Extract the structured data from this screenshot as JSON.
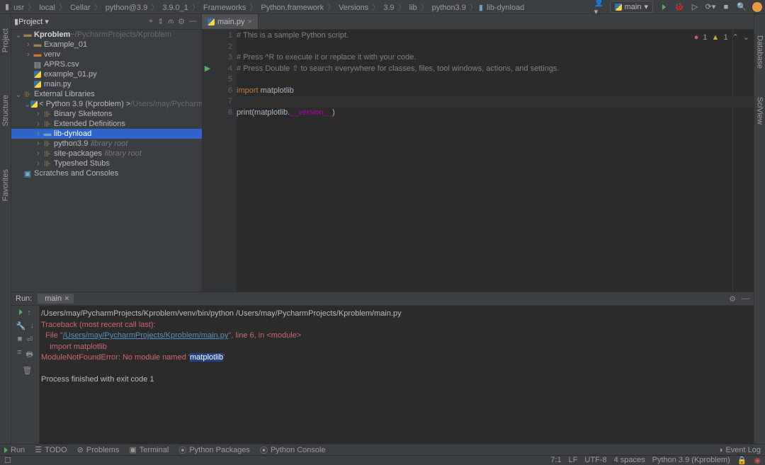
{
  "breadcrumb": [
    "usr",
    "local",
    "Cellar",
    "python@3.9",
    "3.9.0_1",
    "Frameworks",
    "Python.framework",
    "Versions",
    "3.9",
    "lib",
    "python3.9",
    "lib-dynload"
  ],
  "runconfig": {
    "name": "main"
  },
  "top_icons": {
    "run": "run-icon",
    "debug": "bug-icon",
    "more": "more-icon",
    "refresh": "refresh-icon",
    "search": "search-icon"
  },
  "project_panel": {
    "title": "Project",
    "icons": {
      "target": "⌖",
      "collapse": "⇕",
      "split": "⫙",
      "settings": "⚙",
      "hide": "—"
    }
  },
  "tree": [
    {
      "depth": 0,
      "chev": "v",
      "icon": "fld",
      "label": "Kproblem",
      "suffix": "~/PycharmProjects/Kproblem",
      "bold": true
    },
    {
      "depth": 1,
      "chev": ">",
      "icon": "fld",
      "label": "Example_01"
    },
    {
      "depth": 1,
      "chev": ">",
      "icon": "fld-o",
      "label": "venv"
    },
    {
      "depth": 1,
      "chev": "",
      "icon": "file",
      "label": "APRS.csv"
    },
    {
      "depth": 1,
      "chev": "",
      "icon": "py",
      "label": "example_01.py"
    },
    {
      "depth": 1,
      "chev": "",
      "icon": "py",
      "label": "main.py"
    },
    {
      "depth": 0,
      "chev": "v",
      "icon": "ext",
      "label": "External Libraries"
    },
    {
      "depth": 1,
      "chev": "v",
      "icon": "py",
      "label": "< Python 3.9 (Kproblem) >",
      "suffix": "/Users/may/PycharmPro"
    },
    {
      "depth": 2,
      "chev": ">",
      "icon": "lib",
      "label": "Binary Skeletons"
    },
    {
      "depth": 2,
      "chev": ">",
      "icon": "lib",
      "label": "Extended Definitions"
    },
    {
      "depth": 2,
      "chev": ">",
      "icon": "fld-b",
      "label": "lib-dynload",
      "selected": true
    },
    {
      "depth": 2,
      "chev": ">",
      "icon": "lib",
      "label": "python3.9",
      "suffix": "library root"
    },
    {
      "depth": 2,
      "chev": ">",
      "icon": "lib",
      "label": "site-packages",
      "suffix": "library root"
    },
    {
      "depth": 2,
      "chev": ">",
      "icon": "lib",
      "label": "Typeshed Stubs"
    },
    {
      "depth": 0,
      "chev": "",
      "icon": "scratch",
      "label": "Scratches and Consoles"
    }
  ],
  "editor": {
    "tab": "main.py",
    "annotation": {
      "errors": "1",
      "warnings": "1"
    },
    "lines": [
      {
        "n": 1,
        "g": "",
        "t": [
          {
            "c": "cm",
            "v": "# This is a sample Python script."
          }
        ]
      },
      {
        "n": 2,
        "g": "",
        "t": []
      },
      {
        "n": 3,
        "g": "",
        "t": [
          {
            "c": "cm",
            "v": "# Press ^R to execute it or replace it with your code."
          }
        ]
      },
      {
        "n": 4,
        "g": "▶",
        "t": [
          {
            "c": "cm",
            "v": "# Press Double ⇧ to search everywhere for classes, files, tool windows, actions, and settings."
          }
        ]
      },
      {
        "n": 5,
        "g": "",
        "t": []
      },
      {
        "n": 6,
        "g": "",
        "t": [
          {
            "c": "kw",
            "v": "import "
          },
          {
            "c": "id",
            "v": "matplotlib"
          }
        ]
      },
      {
        "n": 7,
        "g": "",
        "t": [],
        "hl": true
      },
      {
        "n": 8,
        "g": "",
        "t": [
          {
            "c": "id",
            "v": "print(matplotlib."
          },
          {
            "c": "dunder",
            "v": "__version__"
          },
          {
            "c": "id",
            "v": ")"
          }
        ]
      }
    ]
  },
  "run": {
    "label": "Run:",
    "tab": "main",
    "cmd": "/Users/may/PycharmProjects/Kproblem/venv/bin/python /Users/may/PycharmProjects/Kproblem/main.py",
    "traceback_head": "Traceback (most recent call last):",
    "file_pre": "  File \"",
    "file_link": "/Users/may/PycharmProjects/Kproblem/main.py",
    "file_post": "\", line 6, in <module>",
    "import_line": "    import matplotlib",
    "err_pre": "ModuleNotFoundError: No module named '",
    "err_mod": "matplotlib",
    "err_post": "'",
    "exit": "Process finished with exit code 1"
  },
  "bottom": {
    "run": "Run",
    "todo": "TODO",
    "problems": "Problems",
    "terminal": "Terminal",
    "pypkg": "Python Packages",
    "pycon": "Python Console",
    "eventlog": "Event Log"
  },
  "status": {
    "pos": "7:1",
    "le": "LF",
    "enc": "UTF-8",
    "indent": "4 spaces",
    "interp": "Python 3.9 (Kproblem)"
  },
  "left_side": [
    "Project",
    "Structure",
    "Favorites"
  ],
  "right_side": [
    "Database",
    "SciView"
  ]
}
